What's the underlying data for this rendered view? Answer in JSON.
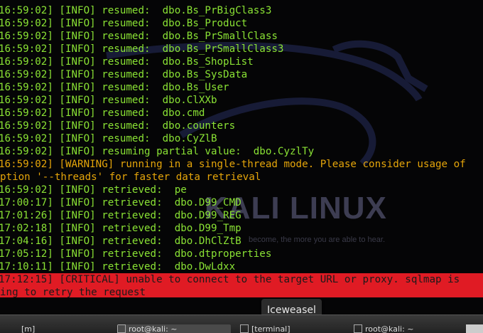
{
  "terminal": {
    "lines": [
      {
        "ts": "16:59:02]",
        "level": "[INFO]",
        "msg": " resumed:  dbo.Bs_PrBigClass3",
        "kind": "info"
      },
      {
        "ts": "16:59:02]",
        "level": "[INFO]",
        "msg": " resumed:  dbo.Bs_Product",
        "kind": "info"
      },
      {
        "ts": "16:59:02]",
        "level": "[INFO]",
        "msg": " resumed:  dbo.Bs_PrSmallClass",
        "kind": "info"
      },
      {
        "ts": "16:59:02]",
        "level": "[INFO]",
        "msg": " resumed:  dbo.Bs_PrSmallClass3",
        "kind": "info"
      },
      {
        "ts": "16:59:02]",
        "level": "[INFO]",
        "msg": " resumed:  dbo.Bs_ShopList",
        "kind": "info"
      },
      {
        "ts": "16:59:02]",
        "level": "[INFO]",
        "msg": " resumed:  dbo.Bs_SysData",
        "kind": "info"
      },
      {
        "ts": "16:59:02]",
        "level": "[INFO]",
        "msg": " resumed:  dbo.Bs_User",
        "kind": "info"
      },
      {
        "ts": "16:59:02]",
        "level": "[INFO]",
        "msg": " resumed:  dbo.ClXXb",
        "kind": "info"
      },
      {
        "ts": "16:59:02]",
        "level": "[INFO]",
        "msg": " resumed:  dbo.cmd",
        "kind": "info"
      },
      {
        "ts": "16:59:02]",
        "level": "[INFO]",
        "msg": " resumed:  dbo.counters",
        "kind": "info"
      },
      {
        "ts": "16:59:02]",
        "level": "[INFO]",
        "msg": " resumed:  dbo.CyZlB",
        "kind": "info"
      },
      {
        "ts": "16:59:02]",
        "level": "[INFO]",
        "msg": " resuming partial value:  dbo.CyzlTy",
        "kind": "info"
      },
      {
        "ts": "16:59:02]",
        "level": "[WARNING]",
        "msg": " running in a single-thread mode. Please consider usage of",
        "kind": "warning"
      },
      {
        "ts": "",
        "level": "",
        "msg": "ption '--threads' for faster data retrieval",
        "kind": "warning"
      },
      {
        "ts": "16:59:02]",
        "level": "[INFO]",
        "msg": " retrieved:  pe",
        "kind": "info"
      },
      {
        "ts": "17:00:17]",
        "level": "[INFO]",
        "msg": " retrieved:  dbo.D99_CMD",
        "kind": "info"
      },
      {
        "ts": "17:01:26]",
        "level": "[INFO]",
        "msg": " retrieved:  dbo.D99_REG",
        "kind": "info"
      },
      {
        "ts": "17:02:18]",
        "level": "[INFO]",
        "msg": " retrieved:  dbo.D99_Tmp",
        "kind": "info"
      },
      {
        "ts": "17:04:16]",
        "level": "[INFO]",
        "msg": " retrieved:  dbo.DhClZtB",
        "kind": "info"
      },
      {
        "ts": "17:05:12]",
        "level": "[INFO]",
        "msg": " retrieved:  dbo.dtproperties",
        "kind": "info"
      },
      {
        "ts": "17:10:11]",
        "level": "[INFO]",
        "msg": " retrieved:  dbo.DwLdxx",
        "kind": "info"
      },
      {
        "ts": "17:12:15]",
        "level": "[CRITICAL]",
        "msg": " unable to connect to the target URL or proxy. sqlmap is",
        "kind": "critical"
      },
      {
        "ts": "",
        "level": "",
        "msg": "ing to retry the request",
        "kind": "critical"
      }
    ]
  },
  "wallpaper": {
    "logo_text": "KALI LINUX",
    "tagline": "become, the more you are able to hear."
  },
  "tooltip": {
    "label": "Iceweasel"
  },
  "taskbar": {
    "items": [
      "[m]",
      "root@kali: ~",
      "[terminal]",
      "root@kali: ~"
    ]
  },
  "colors": {
    "info": "#8ae234",
    "warning": "#e5a50a",
    "critical_bg": "#e01b24",
    "background": "#050506"
  }
}
